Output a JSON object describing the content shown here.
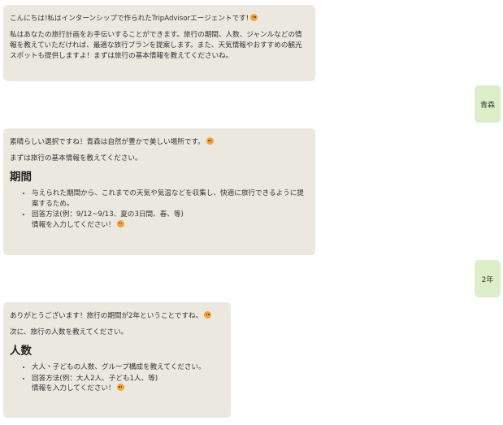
{
  "messages": [
    {
      "role": "bot",
      "paragraphs": [
        "こんにちは!私はインターンシップで作られたTripAdvisorエージェントです!",
        "私はあなたの旅行計画をお手伝いすることができます。旅行の期間、人数、ジャンルなどの情報を教えていただければ、最適な旅行プランを提案します。また、天気情報やおすすめの観光スポットも提供しますよ！まずは旅行の基本情報を教えてくださいね。"
      ],
      "emoji": "smiling-face-icon"
    },
    {
      "role": "user",
      "text": "青森"
    },
    {
      "role": "bot",
      "intro": "素晴らしい選択ですね！青森は自然が豊かで美しい場所です。",
      "sub": "まずは旅行の基本情報を教えてください。",
      "heading": "期間",
      "bullets": [
        "与えられた期間から、これまでの天気や気温などを収集し、快適に旅行できるように提案するため。",
        "回答方法(例：9/12~9/13、夏の3日間、春、等)"
      ],
      "closing": "情報を入力してください！"
    },
    {
      "role": "user",
      "text": "2年"
    },
    {
      "role": "bot",
      "intro": "ありがとうございます！旅行の期間が2年ということですね。",
      "sub": "次に、旅行の人数を教えてください。",
      "heading": "人数",
      "bullets": [
        "大人・子どもの人数、グループ構成を教えてください。",
        "回答方法(例：大人2人、子ども1人、等)"
      ],
      "closing": "情報を入力してください！"
    }
  ]
}
